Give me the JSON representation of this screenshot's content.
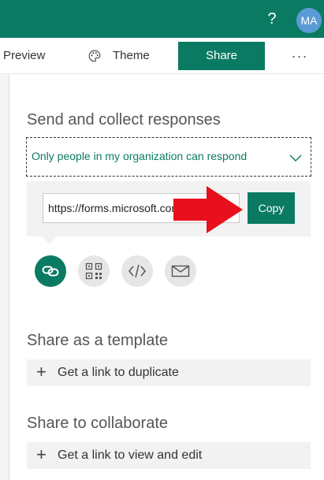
{
  "header": {
    "help_label": "?",
    "avatar_initials": "MA",
    "brand_color": "#0b7a62"
  },
  "toolbar": {
    "preview_label": "Preview",
    "theme_label": "Theme",
    "theme_icon": "palette-icon",
    "share_label": "Share",
    "more_label": "···"
  },
  "send": {
    "title": "Send and collect responses",
    "audience_value": "Only people in my organization can respond",
    "link_value": "https://forms.microsoft.com",
    "copy_label": "Copy",
    "share_methods": [
      "link-icon",
      "qr-code-icon",
      "embed-icon",
      "email-icon"
    ],
    "active_method": "link-icon"
  },
  "template": {
    "title": "Share as a template",
    "action_label": "Get a link to duplicate"
  },
  "collaborate": {
    "title": "Share to collaborate",
    "action_label": "Get a link to view and edit"
  },
  "annotation": {
    "arrow_color": "#e8101c"
  }
}
